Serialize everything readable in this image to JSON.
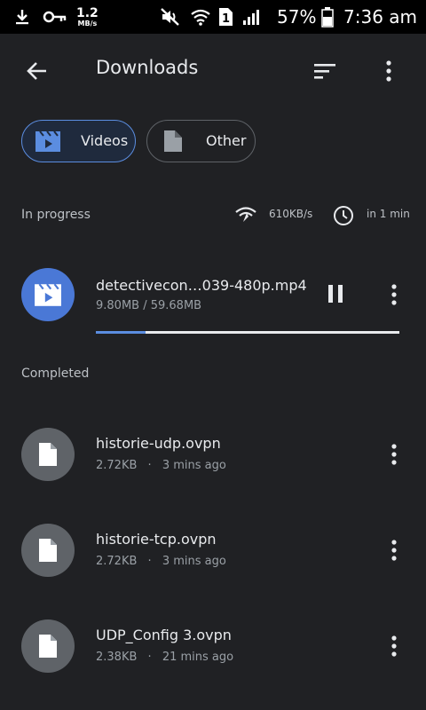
{
  "status_bar": {
    "net_speed_value": "1.2",
    "net_speed_unit": "MB/s",
    "battery_percent": "57%",
    "time": "7:36 am",
    "sim_badge": "1"
  },
  "toolbar": {
    "title": "Downloads"
  },
  "filters": [
    {
      "label": "Videos",
      "selected": true
    },
    {
      "label": "Other",
      "selected": false
    }
  ],
  "in_progress": {
    "header": "In progress",
    "speed": "610KB/s",
    "eta": "in 1 min",
    "item": {
      "name": "detectivecon…039-480p.mp4",
      "size": "9.80MB / 59.68MB",
      "progress_fraction": 0.164
    }
  },
  "completed": {
    "header": "Completed",
    "items": [
      {
        "name": "historie-udp.ovpn",
        "size": "2.72KB",
        "age": "3 mins ago"
      },
      {
        "name": "historie-tcp.ovpn",
        "size": "2.72KB",
        "age": "3 mins ago"
      },
      {
        "name": "UDP_Config 3.ovpn",
        "size": "2.38KB",
        "age": "21 mins ago"
      }
    ],
    "meta_separator": "·"
  },
  "colors": {
    "background": "#202124",
    "accent": "#5b8de0",
    "video_thumb": "#4a78d6",
    "file_thumb": "#5f6368"
  }
}
